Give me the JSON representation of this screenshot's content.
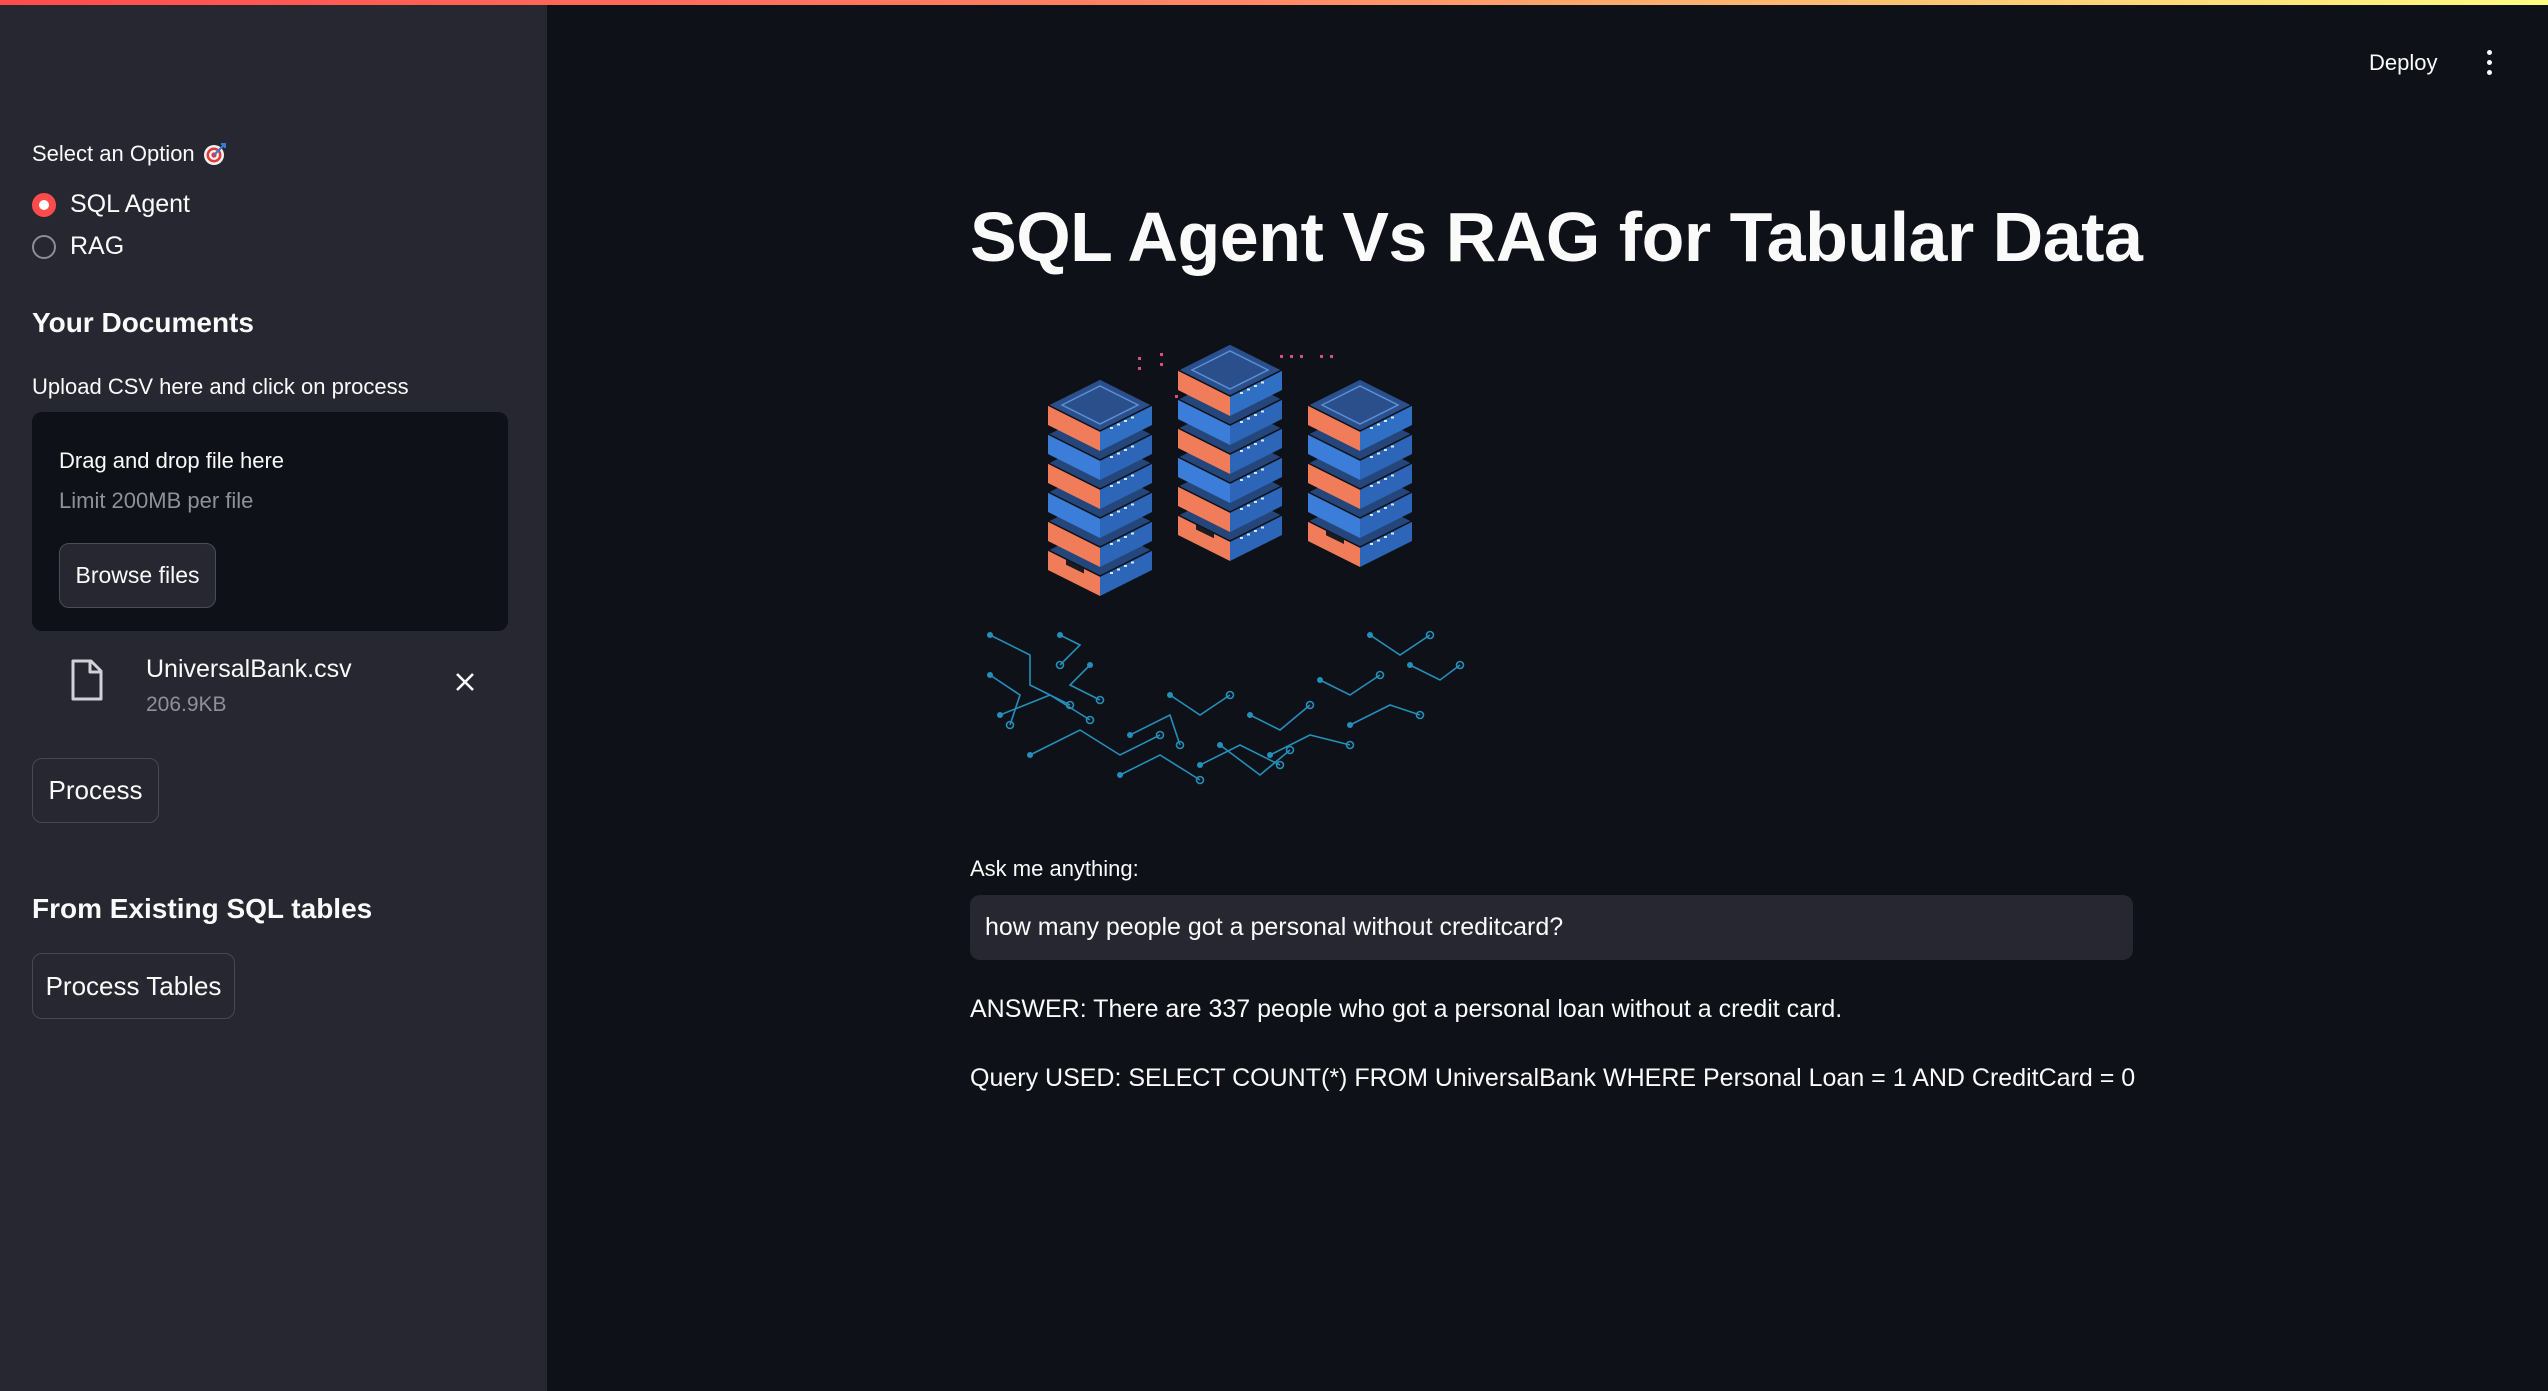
{
  "header": {
    "deploy_label": "Deploy",
    "menu_icon": "kebab-menu-icon"
  },
  "sidebar": {
    "select_label": "Select an Option",
    "select_icon": "target-emoji-icon",
    "options": [
      {
        "label": "SQL Agent",
        "selected": true
      },
      {
        "label": "RAG",
        "selected": false
      }
    ],
    "documents_heading": "Your Documents",
    "upload_label": "Upload CSV here and click on process",
    "dropzone": {
      "title": "Drag and drop file here",
      "limit": "Limit 200MB per file",
      "browse_label": "Browse files"
    },
    "file": {
      "name": "UniversalBank.csv",
      "size": "206.9KB",
      "icon": "file-icon"
    },
    "process_label": "Process",
    "existing_heading": "From Existing SQL tables",
    "process_tables_label": "Process Tables"
  },
  "main": {
    "title": "SQL Agent Vs RAG for Tabular Data",
    "hero_image": "server-stack-illustration",
    "ask_label": "Ask me anything:",
    "question_value": "how many people got a personal without creditcard?",
    "answer": "ANSWER: There are 337 people who got a personal loan without a credit card.",
    "query": "Query USED: SELECT COUNT(*) FROM UniversalBank WHERE Personal Loan = 1 AND CreditCard = 0"
  },
  "colors": {
    "accent": "#ff4b4b",
    "main_bg": "#0e1117",
    "sidebar_bg": "#262730",
    "server_orange": "#f07c5a",
    "server_blue": "#3b7dd8",
    "circuit_blue": "#2aa5d8"
  }
}
